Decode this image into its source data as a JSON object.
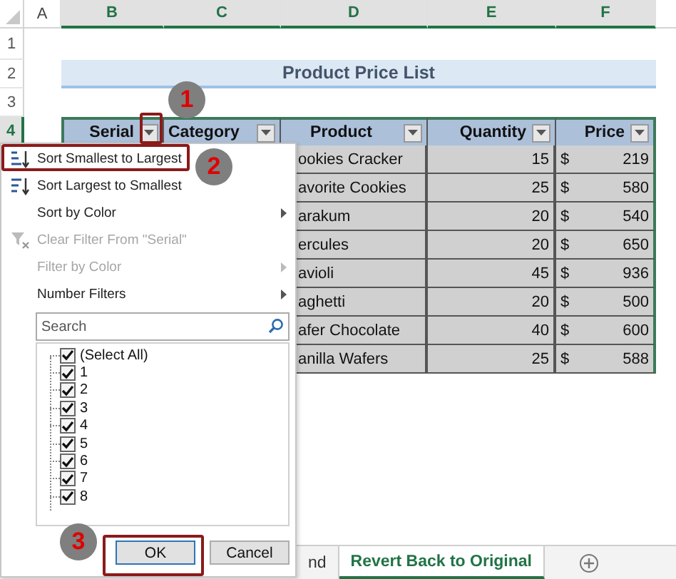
{
  "columns": [
    {
      "label": "A",
      "selected": false
    },
    {
      "label": "B",
      "selected": true
    },
    {
      "label": "C",
      "selected": true
    },
    {
      "label": "D",
      "selected": true
    },
    {
      "label": "E",
      "selected": true
    },
    {
      "label": "F",
      "selected": true
    }
  ],
  "row_numbers": [
    {
      "label": "1",
      "selected": false
    },
    {
      "label": "2",
      "selected": false
    },
    {
      "label": "3",
      "selected": false
    },
    {
      "label": "4",
      "selected": true
    }
  ],
  "title": "Product Price List",
  "table": {
    "headers": [
      {
        "label": "Serial"
      },
      {
        "label": "Category"
      },
      {
        "label": "Product"
      },
      {
        "label": "Quantity"
      },
      {
        "label": "Price"
      }
    ],
    "rows": [
      {
        "product": "ookies Cracker",
        "quantity": "15",
        "currency": "$",
        "price": "219"
      },
      {
        "product": "avorite Cookies",
        "quantity": "25",
        "currency": "$",
        "price": "580"
      },
      {
        "product": "arakum",
        "quantity": "20",
        "currency": "$",
        "price": "540"
      },
      {
        "product": "ercules",
        "quantity": "20",
        "currency": "$",
        "price": "650"
      },
      {
        "product": "avioli",
        "quantity": "45",
        "currency": "$",
        "price": "936"
      },
      {
        "product": "aghetti",
        "quantity": "20",
        "currency": "$",
        "price": "500"
      },
      {
        "product": "afer Chocolate",
        "quantity": "40",
        "currency": "$",
        "price": "600"
      },
      {
        "product": "anilla Wafers",
        "quantity": "25",
        "currency": "$",
        "price": "588"
      }
    ]
  },
  "filter_menu": {
    "items": [
      {
        "label": "Sort Smallest to Largest",
        "kind": "sort_asc",
        "disabled": false,
        "submenu": false
      },
      {
        "label": "Sort Largest to Smallest",
        "kind": "sort_desc",
        "disabled": false,
        "submenu": false
      },
      {
        "label": "Sort by Color",
        "kind": "plain",
        "disabled": false,
        "submenu": true
      },
      {
        "label": "Clear Filter From \"Serial\"",
        "kind": "clear_filter",
        "disabled": true,
        "submenu": false
      },
      {
        "label": "Filter by Color",
        "kind": "plain",
        "disabled": true,
        "submenu": true
      },
      {
        "label": "Number Filters",
        "kind": "plain",
        "disabled": false,
        "submenu": true
      }
    ],
    "search": {
      "placeholder": "Search"
    },
    "values": [
      {
        "label": "(Select All)",
        "checked": true
      },
      {
        "label": "1",
        "checked": true
      },
      {
        "label": "2",
        "checked": true
      },
      {
        "label": "3",
        "checked": true
      },
      {
        "label": "4",
        "checked": true
      },
      {
        "label": "5",
        "checked": true
      },
      {
        "label": "6",
        "checked": true
      },
      {
        "label": "7",
        "checked": true
      },
      {
        "label": "8",
        "checked": true
      }
    ],
    "buttons": [
      {
        "label": "OK",
        "kind": "primary"
      },
      {
        "label": "Cancel",
        "kind": "secondary"
      }
    ]
  },
  "sheet_tabs": [
    {
      "label": "nd",
      "selected": false
    },
    {
      "label": "Revert Back to Original",
      "selected": true
    }
  ],
  "callouts": [
    "1",
    "2",
    "3"
  ]
}
